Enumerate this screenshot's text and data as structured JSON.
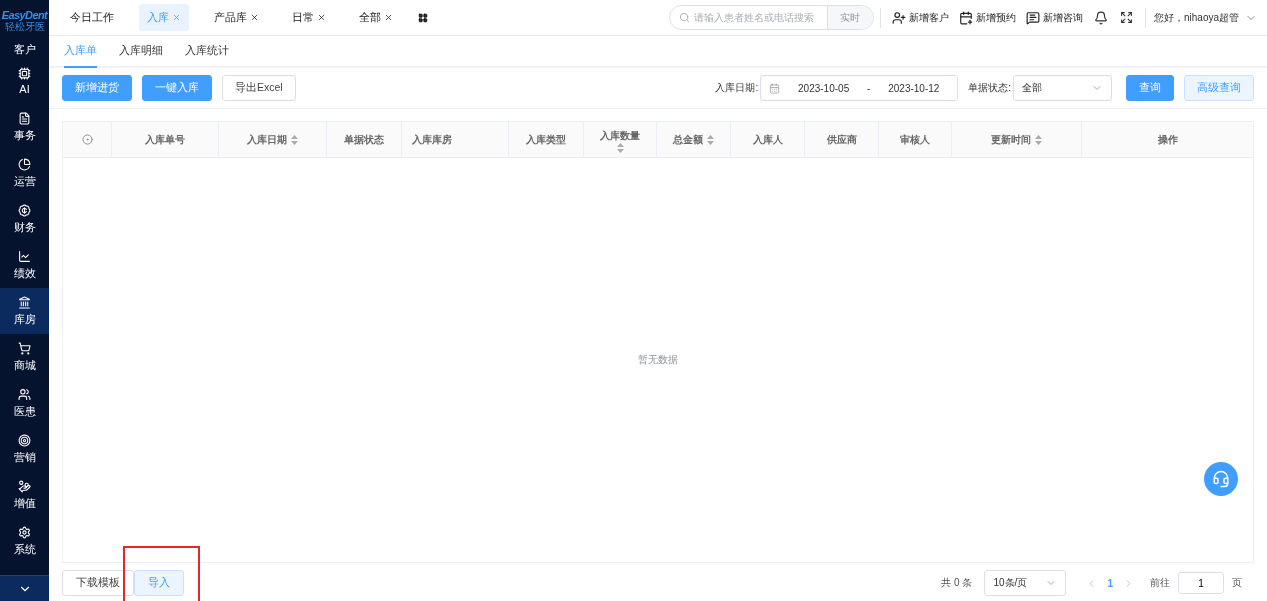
{
  "sidebar": {
    "logo": {
      "brand": "EasyDent",
      "subtitle": "轻松牙医"
    },
    "items": [
      {
        "label": "客户",
        "kind": "label_only",
        "selected": false
      },
      {
        "label": "AI",
        "kind": "icon",
        "selected": false
      },
      {
        "label": "事务",
        "kind": "icon",
        "selected": false
      },
      {
        "label": "运营",
        "kind": "icon",
        "selected": false
      },
      {
        "label": "财务",
        "kind": "icon",
        "selected": false
      },
      {
        "label": "绩效",
        "kind": "icon",
        "selected": false
      },
      {
        "label": "库房",
        "kind": "icon",
        "selected": true
      },
      {
        "label": "商城",
        "kind": "icon",
        "selected": false
      },
      {
        "label": "医患",
        "kind": "icon",
        "selected": false
      },
      {
        "label": "营销",
        "kind": "icon",
        "selected": false
      },
      {
        "label": "增值",
        "kind": "icon",
        "selected": false
      },
      {
        "label": "系统",
        "kind": "icon",
        "selected": false
      }
    ]
  },
  "top_tabs": [
    {
      "label": "今日工作",
      "closable": false,
      "selected": false
    },
    {
      "label": "入库",
      "closable": true,
      "selected": true
    },
    {
      "label": "产品库",
      "closable": true,
      "selected": false
    },
    {
      "label": "日常",
      "closable": true,
      "selected": false
    },
    {
      "label": "全部",
      "closable": true,
      "selected": false
    }
  ],
  "search": {
    "placeholder": "请输入患者姓名或电话搜索",
    "button": "实时"
  },
  "actions": [
    {
      "label": "新增客户"
    },
    {
      "label": "新增预约"
    },
    {
      "label": "新增咨询"
    }
  ],
  "greeting": "您好，nihaoya超管",
  "sub_tabs": [
    {
      "label": "入库单",
      "selected": true
    },
    {
      "label": "入库明细",
      "selected": false
    },
    {
      "label": "入库统计",
      "selected": false
    }
  ],
  "toolbar": {
    "buttons": [
      {
        "label": "新增进货",
        "kind": "primary"
      },
      {
        "label": "一键入库",
        "kind": "primary"
      },
      {
        "label": "导出Excel",
        "kind": "plain"
      }
    ],
    "date_range": {
      "label": "入库日期:",
      "start": "2023-10-05",
      "separator": "-",
      "end": "2023-10-12"
    },
    "status": {
      "label": "单据状态:",
      "value": "全部"
    },
    "query": "查询",
    "advanced_query": "高级查询"
  },
  "table": {
    "columns": [
      {
        "label": "入库单号",
        "sortable": false,
        "kind": "inline"
      },
      {
        "label": "入库日期",
        "sortable": true,
        "kind": "inline"
      },
      {
        "label": "单据状态",
        "sortable": false,
        "kind": "inline"
      },
      {
        "label": "入库库房",
        "sortable": false,
        "kind": "left"
      },
      {
        "label": "入库类型",
        "sortable": false,
        "kind": "inline"
      },
      {
        "label": "入库数量",
        "sortable": true,
        "kind": "stacked"
      },
      {
        "label": "总金额",
        "sortable": true,
        "kind": "inline"
      },
      {
        "label": "入库人",
        "sortable": false,
        "kind": "inline"
      },
      {
        "label": "供应商",
        "sortable": false,
        "kind": "inline"
      },
      {
        "label": "审核人",
        "sortable": false,
        "kind": "inline"
      },
      {
        "label": "更新时间",
        "sortable": true,
        "kind": "inline"
      },
      {
        "label": "操作",
        "sortable": false,
        "kind": "inline"
      }
    ],
    "empty_text": "暂无数据"
  },
  "footer": {
    "buttons": [
      {
        "label": "下载模板",
        "kind": "plain",
        "highlighted": false
      },
      {
        "label": "导入",
        "kind": "light",
        "highlighted": true
      }
    ],
    "pagination": {
      "total": "共 0 条",
      "page_size": "10条/页",
      "pages": [
        {
          "label": "1",
          "selected": true
        }
      ],
      "goto_label": "前往",
      "goto_value": "1",
      "goto_suffix": "页"
    }
  }
}
